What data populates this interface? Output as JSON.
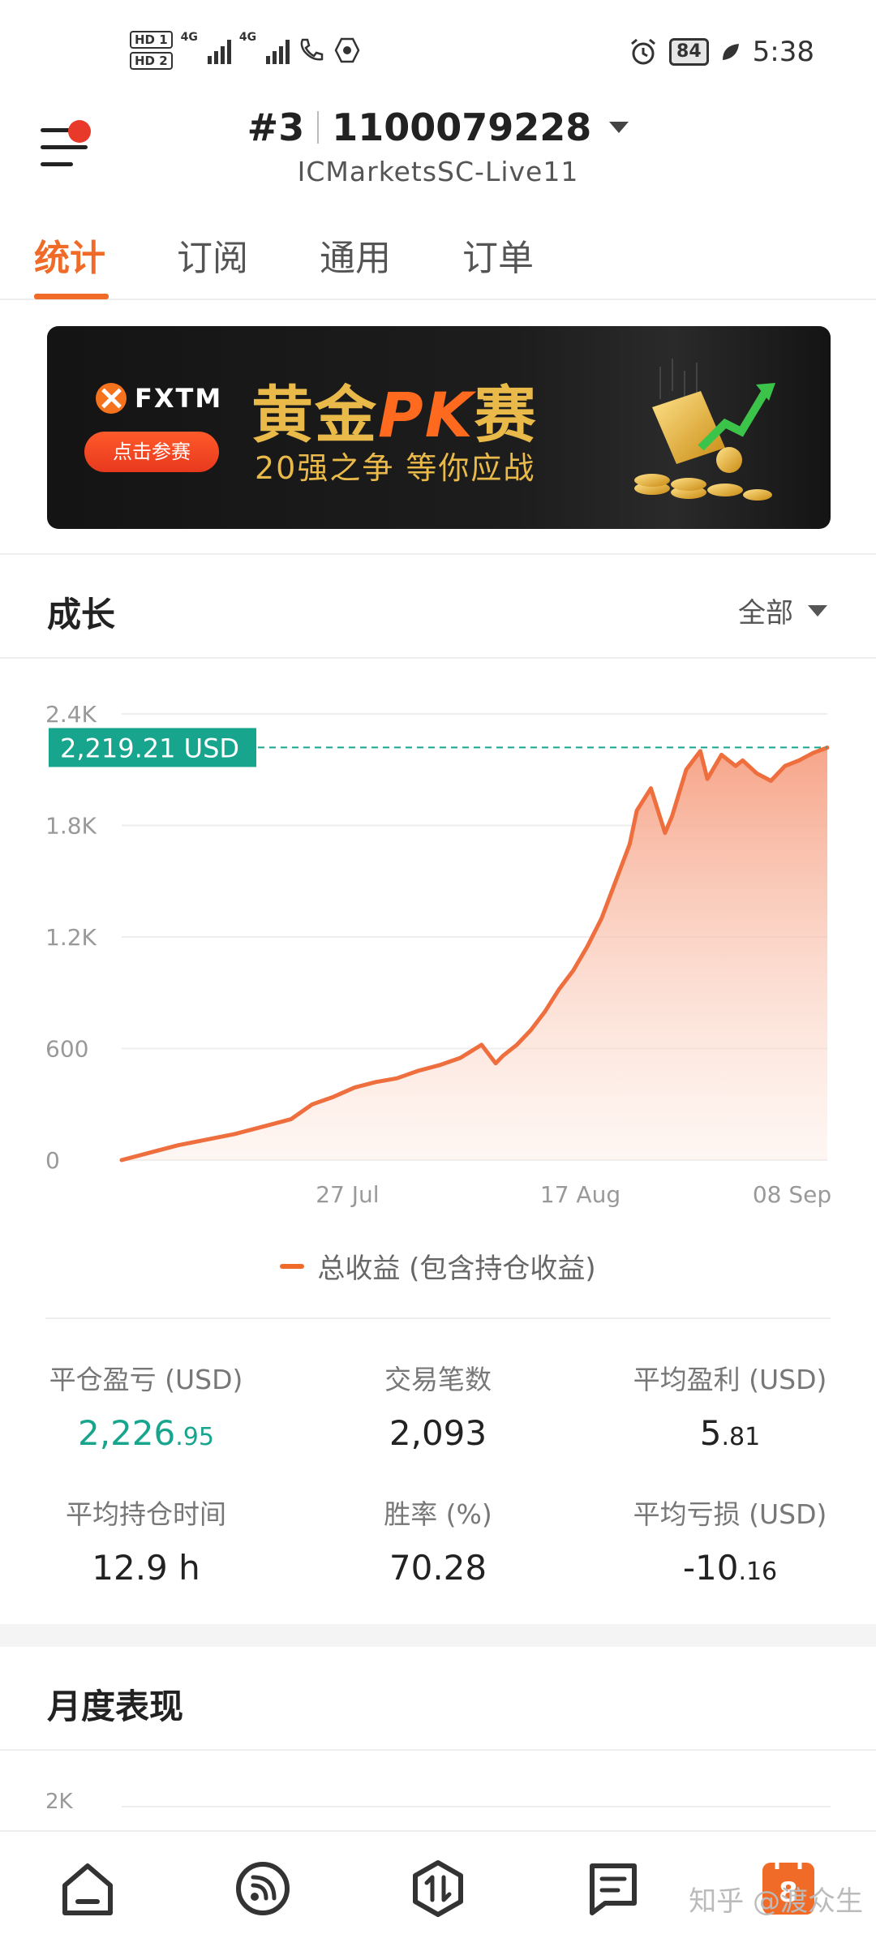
{
  "status_bar": {
    "hd1": "HD 1",
    "hd2": "HD 2",
    "sig1": "4G",
    "sig2": "4G",
    "battery": "84",
    "time": "5:38"
  },
  "header": {
    "account_index": "#3",
    "account_number": "1100079228",
    "server": "ICMarketsSC-Live11"
  },
  "tabs": [
    {
      "label": "统计",
      "active": true
    },
    {
      "label": "订阅",
      "active": false
    },
    {
      "label": "通用",
      "active": false
    },
    {
      "label": "订单",
      "active": false
    }
  ],
  "banner": {
    "brand": "FXTM",
    "cta": "点击参赛",
    "title_pre": "黄金",
    "title_pk": "PK",
    "title_post": "赛",
    "subtitle": "20强之争  等你应战"
  },
  "growth": {
    "title": "成长",
    "range": "全部",
    "legend": "总收益 (包含持仓收益)"
  },
  "chart_data": {
    "type": "area",
    "current_label": "2,219.21 USD",
    "current_value": 2219.21,
    "y_ticks": [
      "0",
      "600",
      "1.2K",
      "1.8K",
      "2.4K"
    ],
    "ylim": [
      0,
      2400
    ],
    "x_tick_labels": [
      "27 Jul",
      "17 Aug",
      "08 Sep"
    ],
    "xlim": [
      0,
      1
    ],
    "x_tick_positions": [
      0.32,
      0.65,
      0.95
    ],
    "series": [
      {
        "x": [
          0.0,
          0.04,
          0.08,
          0.12,
          0.16,
          0.2,
          0.24,
          0.27,
          0.3,
          0.33,
          0.36,
          0.39,
          0.42,
          0.45,
          0.48,
          0.51,
          0.53,
          0.54,
          0.56,
          0.58,
          0.6,
          0.62,
          0.64,
          0.66,
          0.68,
          0.7,
          0.72,
          0.73,
          0.75,
          0.77,
          0.78,
          0.8,
          0.82,
          0.83,
          0.85,
          0.87,
          0.88,
          0.9,
          0.92,
          0.94,
          0.96,
          0.98,
          1.0
        ],
        "y": [
          0,
          40,
          80,
          110,
          140,
          180,
          220,
          300,
          340,
          390,
          420,
          440,
          480,
          510,
          550,
          620,
          520,
          560,
          620,
          700,
          800,
          920,
          1020,
          1150,
          1300,
          1500,
          1700,
          1880,
          2000,
          1760,
          1850,
          2100,
          2200,
          2050,
          2180,
          2120,
          2150,
          2080,
          2040,
          2120,
          2150,
          2190,
          2219
        ]
      }
    ]
  },
  "stats": [
    {
      "label": "平仓盈亏 (USD)",
      "main": "2,226",
      "decimals": ".95",
      "color": "green"
    },
    {
      "label": "交易笔数",
      "main": "2,093",
      "decimals": "",
      "color": "default"
    },
    {
      "label": "平均盈利 (USD)",
      "main": "5",
      "decimals": ".81",
      "color": "default"
    },
    {
      "label": "平均持仓时间",
      "main": "12.9 h",
      "decimals": "",
      "color": "default"
    },
    {
      "label": "胜率 (%)",
      "main": "70.28",
      "decimals": "",
      "color": "default"
    },
    {
      "label": "平均亏损 (USD)",
      "main": "-10",
      "decimals": ".16",
      "color": "default"
    }
  ],
  "monthly": {
    "title": "月度表现",
    "y_tick": "2K"
  },
  "bottom_nav": {
    "items": [
      "home-icon",
      "feed-icon",
      "trade-icon",
      "message-icon",
      "calendar-icon"
    ],
    "calendar_day": "8",
    "accent": "#f06a28"
  },
  "watermark": "知乎 @渡众生"
}
